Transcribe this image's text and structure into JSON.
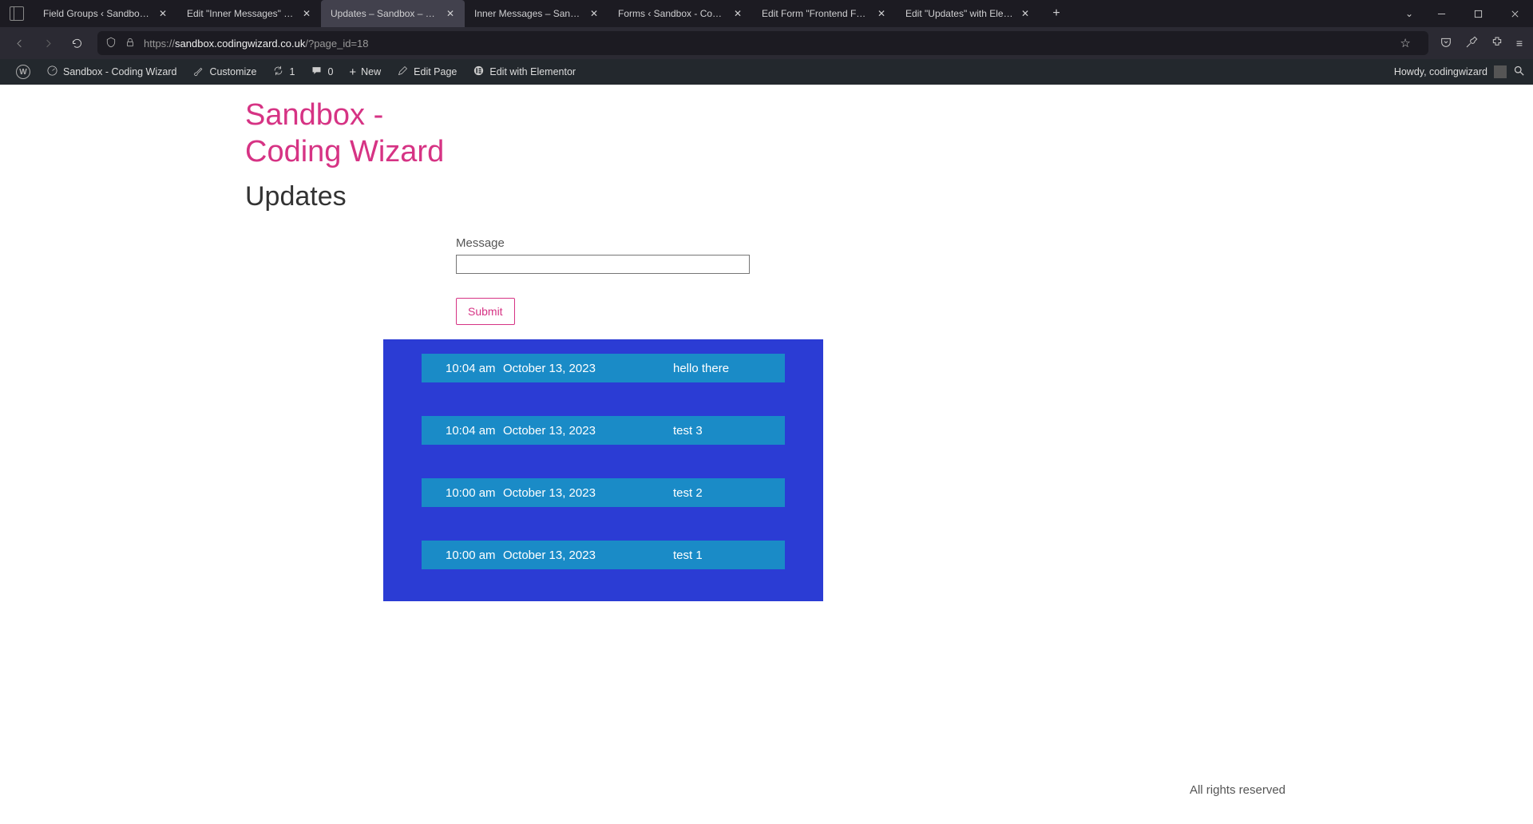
{
  "browser": {
    "tabs": [
      {
        "title": "Field Groups ‹ Sandbox - Coding Wi"
      },
      {
        "title": "Edit \"Inner Messages\" with Element"
      },
      {
        "title": "Updates – Sandbox – Coding Wizard"
      },
      {
        "title": "Inner Messages – Sandbox – Codin"
      },
      {
        "title": "Forms ‹ Sandbox - Coding Wizard -"
      },
      {
        "title": "Edit Form \"Frontend Form\" ‹ Sandb"
      },
      {
        "title": "Edit \"Updates\" with Elementor"
      }
    ],
    "active_tab_index": 2,
    "url_dim_prefix": "https://",
    "url_host": "sandbox.codingwizard.co.uk",
    "url_path": "/?page_id=18"
  },
  "wpbar": {
    "site_name": "Sandbox - Coding Wizard",
    "customize": "Customize",
    "updates_count": "1",
    "comments_count": "0",
    "new_label": "New",
    "edit_page": "Edit Page",
    "edit_elementor": "Edit with Elementor",
    "howdy": "Howdy, codingwizard"
  },
  "page": {
    "site_title": "Sandbox - Coding Wizard",
    "page_title": "Updates",
    "form": {
      "message_label": "Message",
      "message_value": "",
      "submit_label": "Submit"
    },
    "messages": [
      {
        "time": "10:04 am",
        "date": "October 13, 2023",
        "text": "hello there"
      },
      {
        "time": "10:04 am",
        "date": "October 13, 2023",
        "text": "test 3"
      },
      {
        "time": "10:00 am",
        "date": "October 13, 2023",
        "text": "test 2"
      },
      {
        "time": "10:00 am",
        "date": "October 13, 2023",
        "text": "test 1"
      }
    ],
    "footer": "All rights reserved"
  }
}
